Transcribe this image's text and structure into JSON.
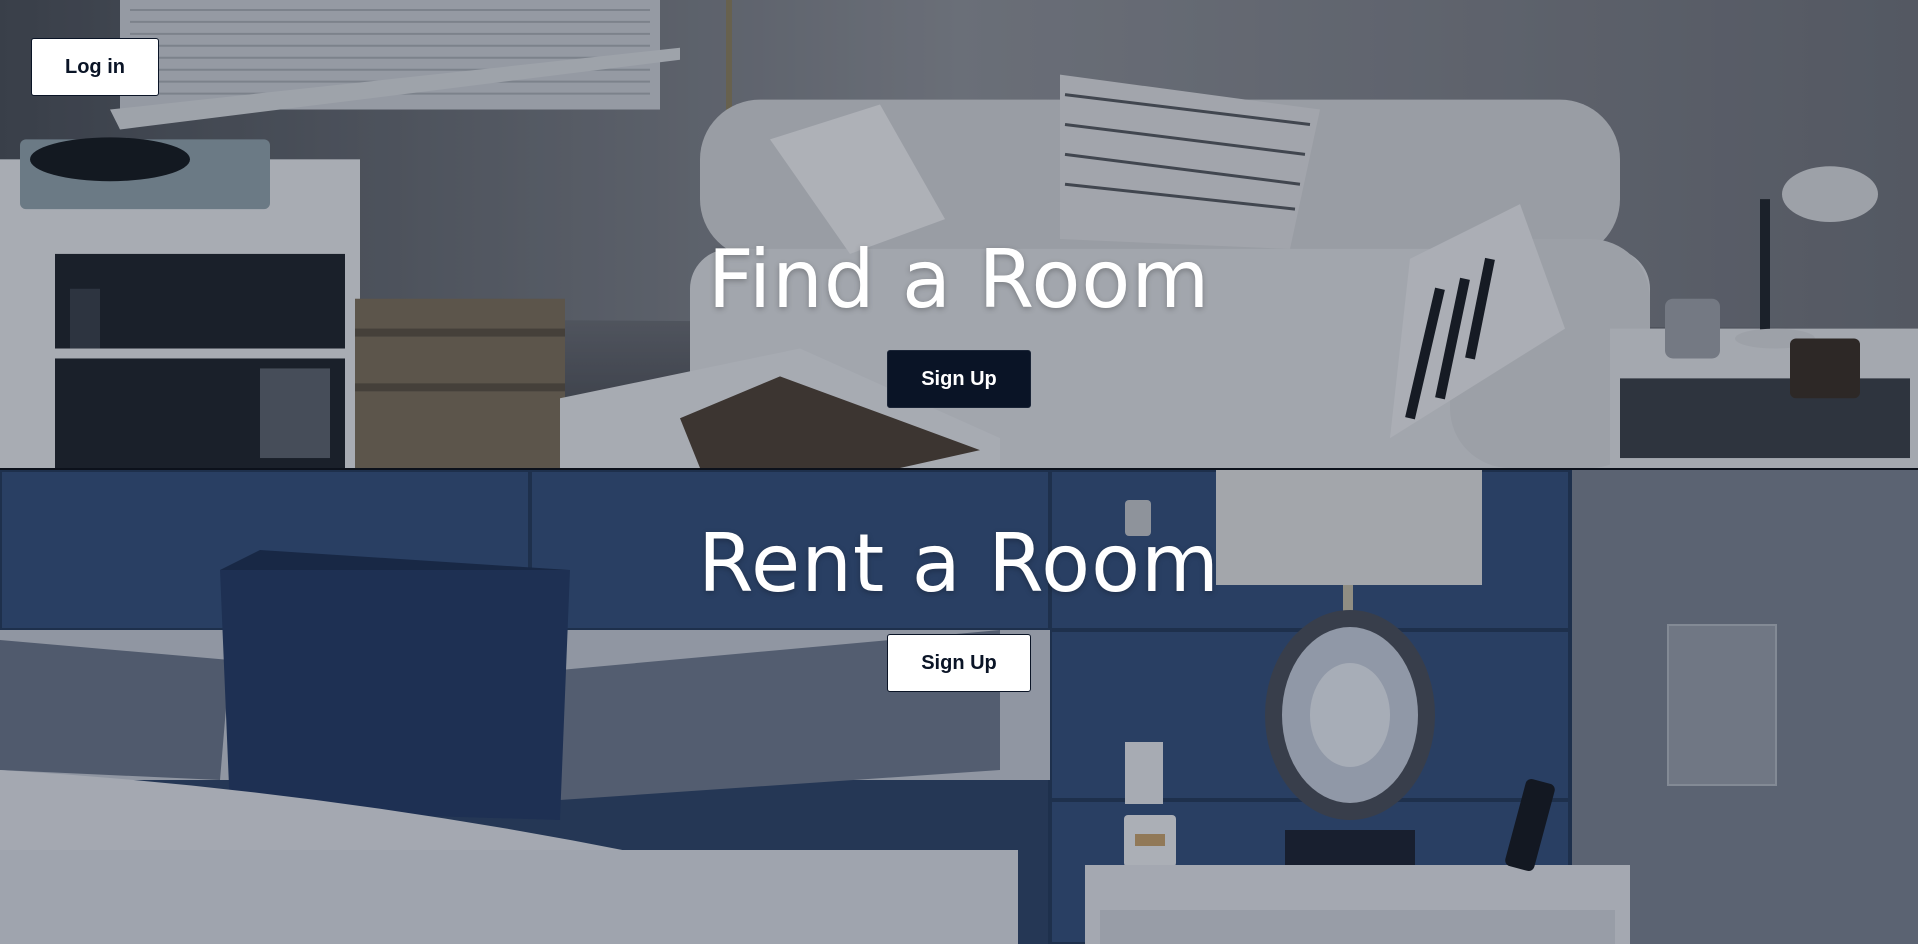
{
  "header": {
    "login_label": "Log in"
  },
  "sections": [
    {
      "title": "Find a Room",
      "button_label": "Sign Up"
    },
    {
      "title": "Rent a Room",
      "button_label": "Sign Up"
    }
  ],
  "colors": {
    "button_dark": "#0a1426",
    "button_light": "#ffffff",
    "title_text": "#ffffff"
  }
}
